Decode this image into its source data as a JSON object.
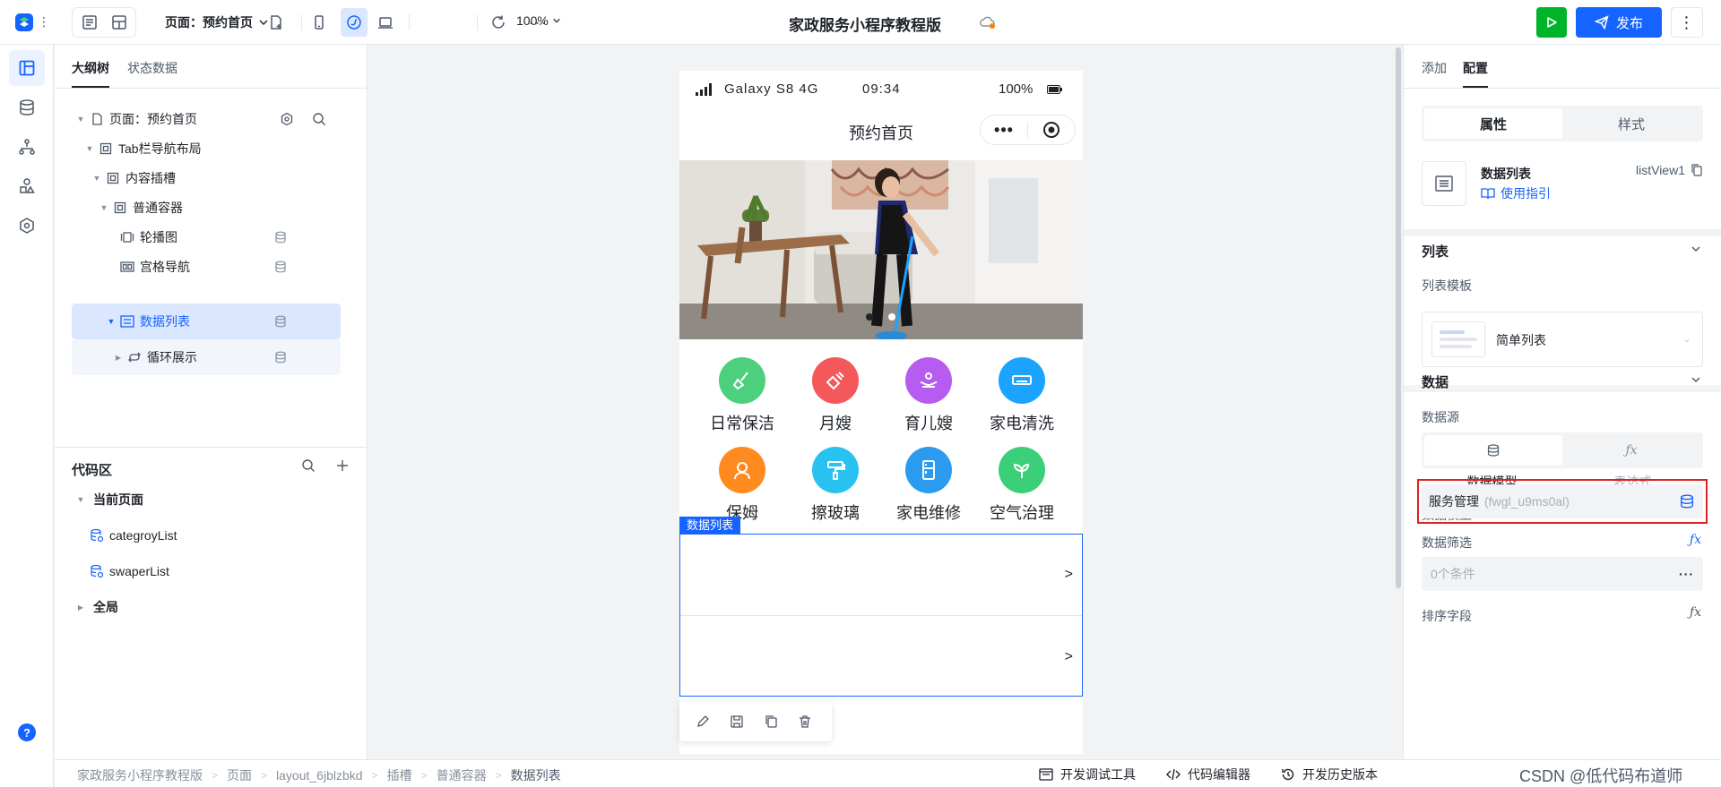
{
  "topbar": {
    "page_select": "页面：预约首页",
    "zoom": "100%",
    "app_title": "家政服务小程序教程版",
    "publish": "发布"
  },
  "left_panel": {
    "tabs": [
      "大纲树",
      "状态数据"
    ],
    "tree": [
      {
        "label": "页面：预约首页"
      },
      {
        "label": "Tab栏导航布局"
      },
      {
        "label": "内容插槽"
      },
      {
        "label": "普通容器"
      },
      {
        "label": "轮播图"
      },
      {
        "label": "宫格导航"
      },
      {
        "label": "数据列表"
      },
      {
        "label": "循环展示"
      }
    ],
    "code_section": {
      "title": "代码区",
      "current_page": "当前页面",
      "items": [
        "categroyList",
        "swaperList"
      ],
      "global": "全局"
    }
  },
  "phone": {
    "status": {
      "carrier": "Galaxy S8  4G",
      "time": "09:34",
      "battery": "100%"
    },
    "title": "预约首页",
    "grid": [
      {
        "label": "日常保洁",
        "color": "#4cd07d"
      },
      {
        "label": "月嫂",
        "color": "#f5585b"
      },
      {
        "label": "育儿嫂",
        "color": "#b65cf0"
      },
      {
        "label": "家电清洗",
        "color": "#1aa3ff"
      },
      {
        "label": "保姆",
        "color": "#ff8a1f"
      },
      {
        "label": "擦玻璃",
        "color": "#29c2f0"
      },
      {
        "label": "家电维修",
        "color": "#2b9bf0"
      },
      {
        "label": "空气治理",
        "color": "#3ccf79"
      }
    ],
    "list_tag": "数据列表"
  },
  "right_panel": {
    "tabs": [
      "添加",
      "配置"
    ],
    "segment": [
      "属性",
      "样式"
    ],
    "component": {
      "name": "数据列表",
      "guide": "使用指引",
      "id": "listView1"
    },
    "list_section": {
      "title": "列表",
      "template_label": "列表模板",
      "template_value": "简单列表"
    },
    "data_section": {
      "title": "数据",
      "source_label": "数据源",
      "source_options": [
        "数据模型",
        "表达式"
      ],
      "model_label": "数据模型",
      "model_required": "*",
      "model_value": "服务管理",
      "model_sub": "(fwgl_u9ms0al)",
      "filter_label": "数据筛选",
      "filter_value": "0个条件",
      "sort_label": "排序字段"
    }
  },
  "bottombar": {
    "crumbs": [
      "家政服务小程序教程版",
      "页面",
      "layout_6jblzbkd",
      "插槽",
      "普通容器",
      "数据列表"
    ],
    "tools": [
      "开发调试工具",
      "代码编辑器",
      "开发历史版本"
    ],
    "watermark": "CSDN @低代码布道师"
  }
}
